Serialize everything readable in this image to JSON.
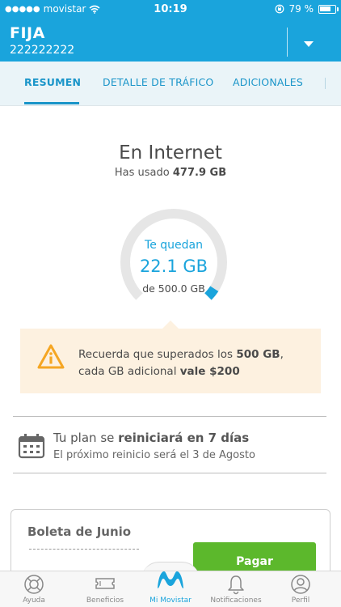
{
  "status_bar": {
    "carrier": "movistar",
    "time": "10:19",
    "battery_percent": "79 %",
    "battery_level": 0.79
  },
  "header": {
    "title": "FIJA",
    "number": "222222222"
  },
  "tabs": [
    {
      "label": "RESUMEN",
      "active": true
    },
    {
      "label": "DETALLE DE TRÁFICO",
      "active": false
    },
    {
      "label": "ADICIONALES",
      "active": false
    }
  ],
  "usage": {
    "title": "En Internet",
    "used_prefix": "Has usado",
    "used_value": "477.9 GB",
    "gauge_label": "Te quedan",
    "remaining": "22.1 GB",
    "total": "de 500.0 GB",
    "remaining_fraction": 0.044
  },
  "notice": {
    "text_1": "Recuerda que superados los ",
    "bold_1": "500 GB",
    "text_2": ",",
    "text_3": "cada GB adicional ",
    "bold_2": "vale $200"
  },
  "plan": {
    "text_1": "Tu plan se ",
    "bold": "reiniciará en 7 días",
    "line_2": "El próximo reinicio será el 3 de Agosto"
  },
  "boleta": {
    "title": "Boleta de Junio",
    "pay_label": "Pagar"
  },
  "bottom_nav": [
    {
      "label": "Ayuda",
      "icon": "help-lifebuoy-icon"
    },
    {
      "label": "Beneficios",
      "icon": "ticket-icon"
    },
    {
      "label": "Mi Movistar",
      "icon": "movistar-logo-icon",
      "active": true
    },
    {
      "label": "Notificaciones",
      "icon": "bell-icon"
    },
    {
      "label": "Perfil",
      "icon": "profile-icon"
    }
  ],
  "colors": {
    "brand_blue": "#1aa4dc",
    "pay_green": "#5cb82c",
    "warning_orange": "#f5a623",
    "notice_bg": "#fdf1e0"
  }
}
